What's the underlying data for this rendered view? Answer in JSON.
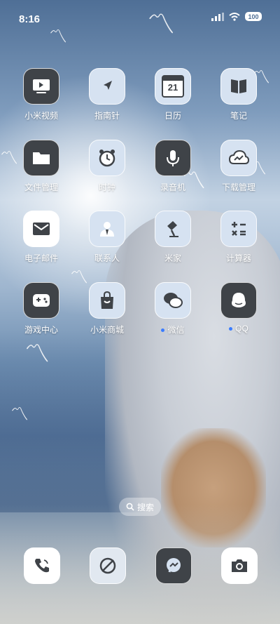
{
  "status_bar": {
    "time": "8:16",
    "battery": "100"
  },
  "apps": [
    {
      "label": "小米视频",
      "icon": "video-icon"
    },
    {
      "label": "指南针",
      "icon": "compass-icon"
    },
    {
      "label": "日历",
      "icon": "calendar-icon",
      "day": "21"
    },
    {
      "label": "笔记",
      "icon": "notes-icon"
    },
    {
      "label": "文件管理",
      "icon": "folder-icon"
    },
    {
      "label": "时钟",
      "icon": "clock-icon"
    },
    {
      "label": "录音机",
      "icon": "microphone-icon"
    },
    {
      "label": "下载管理",
      "icon": "download-cloud-icon"
    },
    {
      "label": "电子邮件",
      "icon": "mail-icon"
    },
    {
      "label": "联系人",
      "icon": "contacts-icon"
    },
    {
      "label": "米家",
      "icon": "lamp-icon"
    },
    {
      "label": "计算器",
      "icon": "calculator-icon"
    },
    {
      "label": "游戏中心",
      "icon": "gamepad-icon"
    },
    {
      "label": "小米商城",
      "icon": "shopping-bag-icon"
    },
    {
      "label": "微信",
      "icon": "wechat-icon",
      "badge": "new"
    },
    {
      "label": "QQ",
      "icon": "qq-icon",
      "badge": "new"
    }
  ],
  "search": {
    "label": "搜索"
  },
  "dock": [
    {
      "icon": "phone-icon"
    },
    {
      "icon": "browser-icon"
    },
    {
      "icon": "messages-icon"
    },
    {
      "icon": "camera-icon"
    }
  ]
}
